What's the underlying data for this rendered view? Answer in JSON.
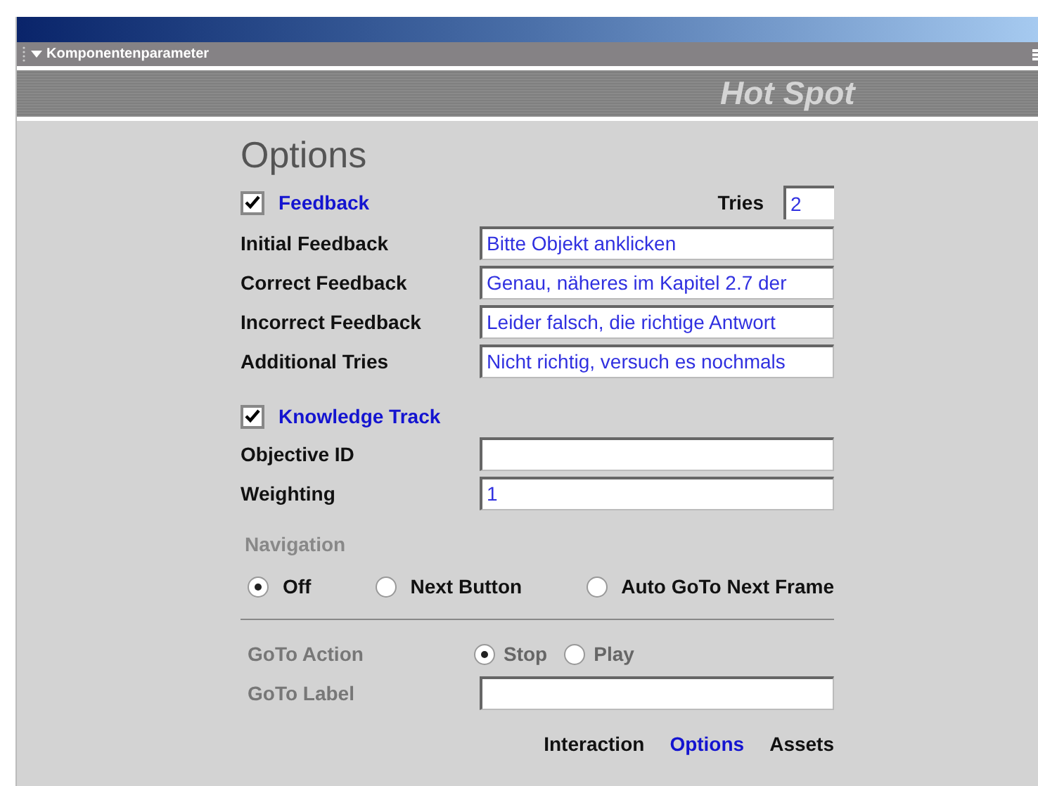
{
  "panel": {
    "title": "Komponentenparameter",
    "expanded": true
  },
  "banner": {
    "title": "Hot Spot"
  },
  "section_title": "Options",
  "feedback": {
    "label": "Feedback",
    "checked": true,
    "tries_label": "Tries",
    "tries": "2"
  },
  "feedback_fields": [
    {
      "label": "Initial Feedback",
      "value": "Bitte Objekt anklicken"
    },
    {
      "label": "Correct Feedback",
      "value": "Genau, näheres im Kapitel 2.7 der"
    },
    {
      "label": "Incorrect Feedback",
      "value": "Leider falsch, die richtige Antwort"
    },
    {
      "label": "Additional Tries",
      "value": "Nicht richtig, versuch es nochmals"
    }
  ],
  "knowledge_track": {
    "label": "Knowledge Track",
    "checked": true
  },
  "track_fields": [
    {
      "label": "Objective ID"
    },
    {
      "label": "Weighting",
      "value": "1"
    }
  ],
  "navigation": {
    "label": "Navigation",
    "options": [
      {
        "label": "Off",
        "selected": true
      },
      {
        "label": "Next Button",
        "selected": false
      },
      {
        "label": "Auto GoTo Next Frame",
        "selected": false
      }
    ]
  },
  "goto_action": {
    "label": "GoTo Action",
    "disabled": true,
    "options": [
      {
        "label": "Stop",
        "selected": true
      },
      {
        "label": "Play",
        "selected": false
      }
    ]
  },
  "goto_label": {
    "label": "GoTo Label"
  },
  "tabs": [
    {
      "label": "Interaction",
      "selected": false
    },
    {
      "label": "Options",
      "selected": true
    },
    {
      "label": "Assets",
      "selected": false
    }
  ]
}
